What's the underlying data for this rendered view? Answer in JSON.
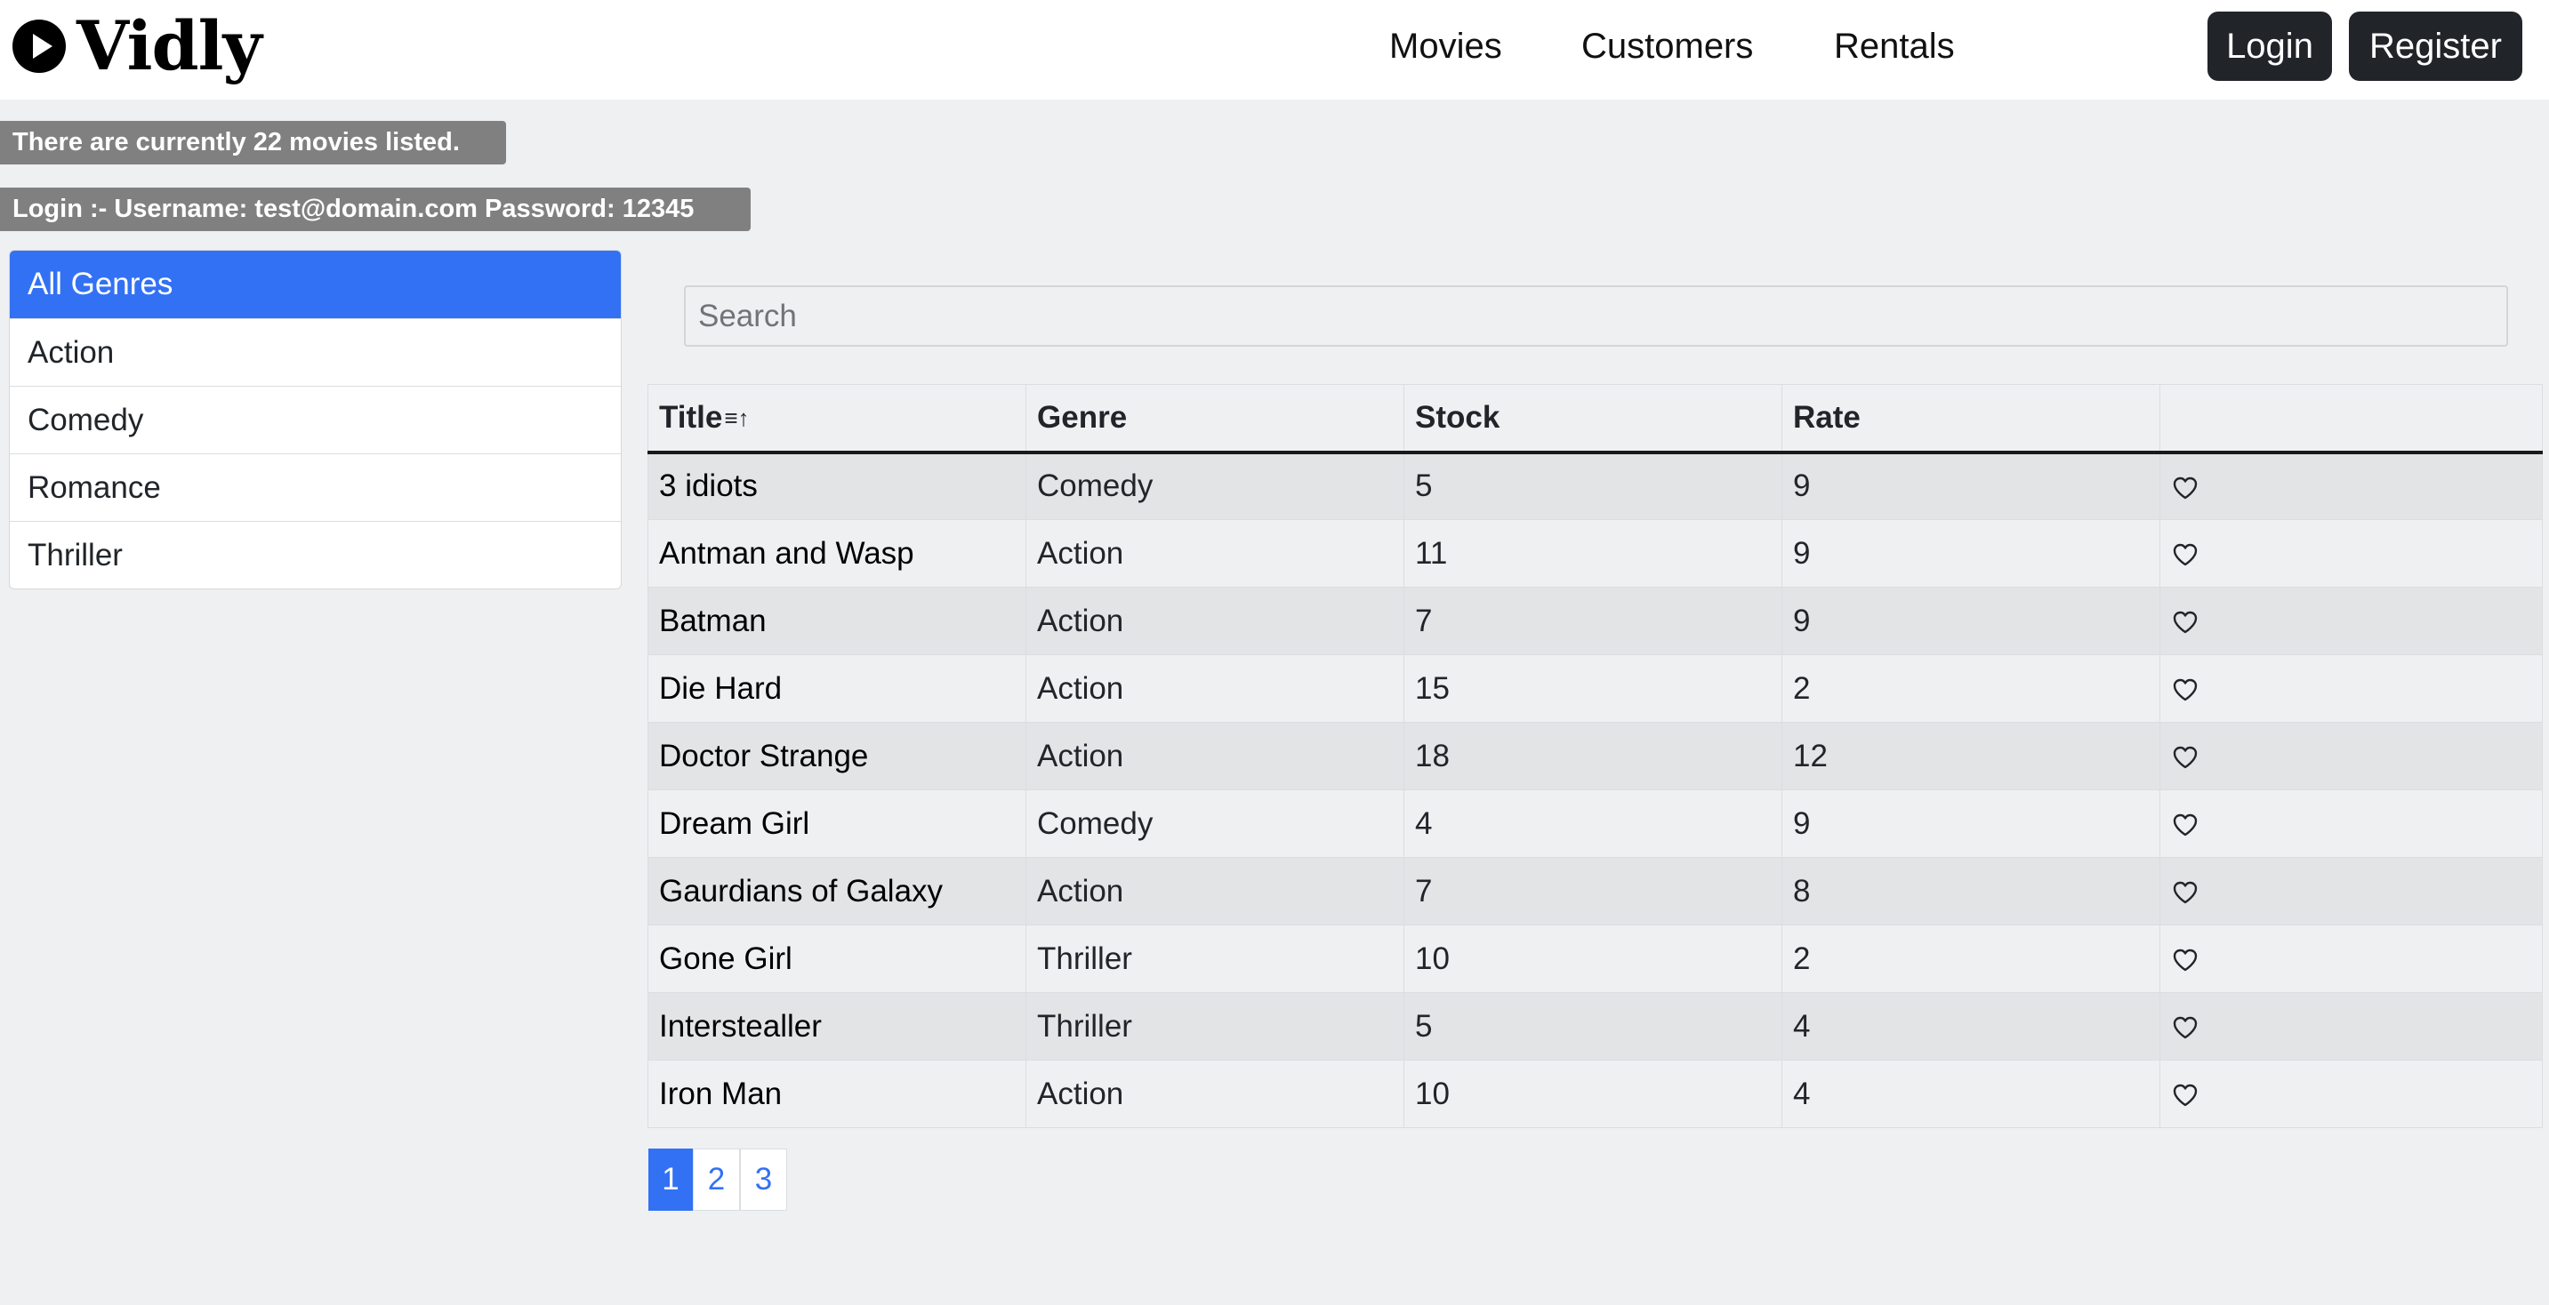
{
  "navbar": {
    "brand": "Vidly",
    "links": [
      "Movies",
      "Customers",
      "Rentals"
    ],
    "login_label": "Login",
    "register_label": "Register"
  },
  "messages": {
    "movie_count": "There are currently 22 movies listed.",
    "login_hint": "Login :- Username: test@domain.com Password: 12345"
  },
  "genres": {
    "items": [
      "All Genres",
      "Action",
      "Comedy",
      "Romance",
      "Thriller"
    ],
    "selected": "All Genres"
  },
  "search": {
    "placeholder": "Search",
    "value": ""
  },
  "table": {
    "headers": [
      "Title",
      "Genre",
      "Stock",
      "Rate",
      ""
    ],
    "sort_icon": "sort-alpha-ascending-icon",
    "rows": [
      {
        "title": "3 idiots",
        "genre": "Comedy",
        "stock": "5",
        "rate": "9"
      },
      {
        "title": "Antman and Wasp",
        "genre": "Action",
        "stock": "11",
        "rate": "9"
      },
      {
        "title": "Batman",
        "genre": "Action",
        "stock": "7",
        "rate": "9"
      },
      {
        "title": "Die Hard",
        "genre": "Action",
        "stock": "15",
        "rate": "2"
      },
      {
        "title": "Doctor Strange",
        "genre": "Action",
        "stock": "18",
        "rate": "12"
      },
      {
        "title": "Dream Girl",
        "genre": "Comedy",
        "stock": "4",
        "rate": "9"
      },
      {
        "title": "Gaurdians of Galaxy",
        "genre": "Action",
        "stock": "7",
        "rate": "8"
      },
      {
        "title": "Gone Girl",
        "genre": "Thriller",
        "stock": "10",
        "rate": "2"
      },
      {
        "title": "Interstealler",
        "genre": "Thriller",
        "stock": "5",
        "rate": "4"
      },
      {
        "title": "Iron Man",
        "genre": "Action",
        "stock": "10",
        "rate": "4"
      }
    ]
  },
  "pagination": {
    "pages": [
      "1",
      "2",
      "3"
    ],
    "current": "1"
  },
  "colors": {
    "accent": "#3371f4",
    "dark_button": "#212529",
    "badge": "#808080",
    "background": "#eff0f2"
  }
}
